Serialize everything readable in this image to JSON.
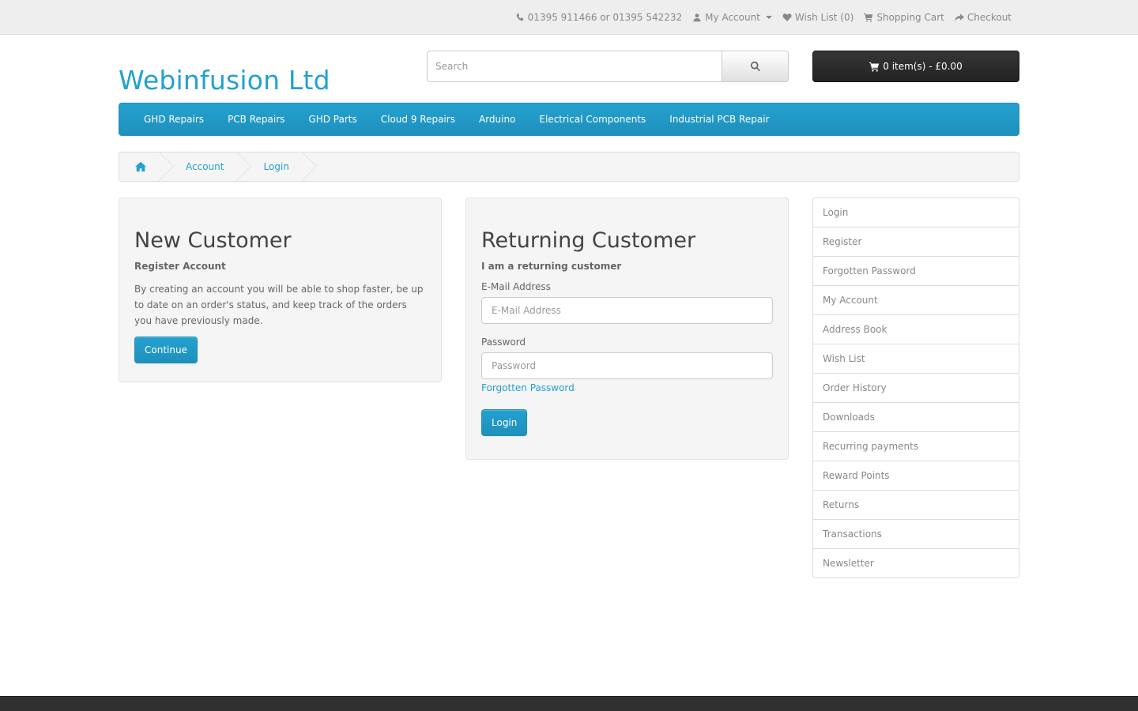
{
  "topbar": {
    "phone": "01395 911466 or 01395 542232",
    "my_account": "My Account",
    "wish_list": "Wish List (0)",
    "shopping_cart": "Shopping Cart",
    "checkout": "Checkout"
  },
  "header": {
    "logo": "Webinfusion Ltd",
    "search_placeholder": "Search",
    "cart_label": "0 item(s) - £0.00"
  },
  "menu": {
    "items": [
      "GHD Repairs",
      "PCB Repairs",
      "GHD Parts",
      "Cloud 9 Repairs",
      "Arduino",
      "Electrical Components",
      "Industrial PCB Repair"
    ]
  },
  "breadcrumb": {
    "items": [
      "Account",
      "Login"
    ]
  },
  "new_customer": {
    "title": "New Customer",
    "subtitle": "Register Account",
    "description": "By creating an account you will be able to shop faster, be up to date on an order's status, and keep track of the orders you have previously made.",
    "button": "Continue"
  },
  "returning_customer": {
    "title": "Returning Customer",
    "subtitle": "I am a returning customer",
    "email_label": "E-Mail Address",
    "email_placeholder": "E-Mail Address",
    "password_label": "Password",
    "password_placeholder": "Password",
    "forgotten_link": "Forgotten Password",
    "button": "Login"
  },
  "sidebar": {
    "items": [
      "Login",
      "Register",
      "Forgotten Password",
      "My Account",
      "Address Book",
      "Wish List",
      "Order History",
      "Downloads",
      "Recurring payments",
      "Reward Points",
      "Returns",
      "Transactions",
      "Newsletter"
    ]
  },
  "colors": {
    "accent": "#23a1d1",
    "cart_bg": "#303030",
    "footer_bg": "#303030"
  }
}
